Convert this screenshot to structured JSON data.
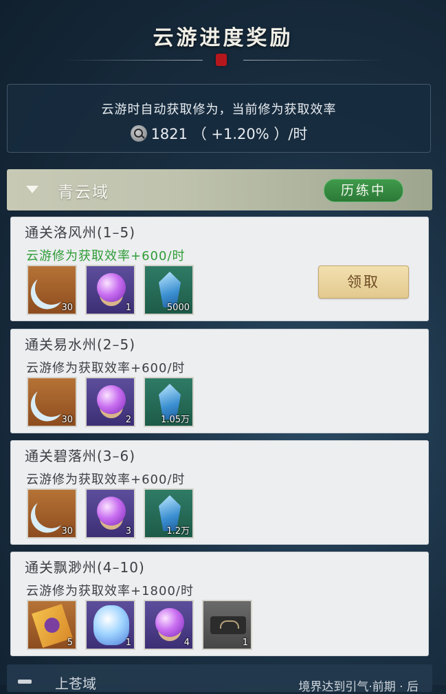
{
  "title": "云游进度奖励",
  "info": {
    "line1": "云游时自动获取修为，当前修为获取效率",
    "rate_value": "1821",
    "rate_bonus": "（ +1.20% ）/时"
  },
  "region": {
    "name": "青云域",
    "status": "历练中"
  },
  "cards": [
    {
      "title": "通关洛风州(1–5)",
      "effect": "云游修为获取效率+600/时",
      "items": [
        {
          "icon": "crescent-blade-icon",
          "count": "30"
        },
        {
          "icon": "purple-orb-icon",
          "count": "1"
        },
        {
          "icon": "blue-crystal-icon",
          "count": "5000"
        }
      ],
      "claim_label": "领取"
    },
    {
      "title": "通关易水州(2–5)",
      "effect": "云游修为获取效率+600/时",
      "items": [
        {
          "icon": "crescent-blade-icon",
          "count": "30"
        },
        {
          "icon": "purple-orb-icon",
          "count": "2"
        },
        {
          "icon": "blue-crystal-icon",
          "count": "1.05万"
        }
      ]
    },
    {
      "title": "通关碧落州(3–6)",
      "effect": "云游修为获取效率+600/时",
      "items": [
        {
          "icon": "crescent-blade-icon",
          "count": "30"
        },
        {
          "icon": "purple-orb-icon",
          "count": "3"
        },
        {
          "icon": "blue-crystal-icon",
          "count": "1.2万"
        }
      ]
    },
    {
      "title": "通关飘渺州(4–10)",
      "effect": "云游修为获取效率+1800/时",
      "items": [
        {
          "icon": "ticket-scroll-icon",
          "count": "5"
        },
        {
          "icon": "spirit-pet-icon",
          "count": "1"
        },
        {
          "icon": "purple-orb-icon",
          "count": "4"
        },
        {
          "icon": "dark-mask-icon",
          "count": "1"
        }
      ]
    }
  ],
  "next_region": {
    "name": "上苍域",
    "note": "境界达到引气·前期 · 后"
  },
  "colors": {
    "accent_green": "#2f9c36",
    "badge_green": "#3f9a4b",
    "claim_gold": "#e2c98e",
    "seal_red": "#b5171d"
  }
}
